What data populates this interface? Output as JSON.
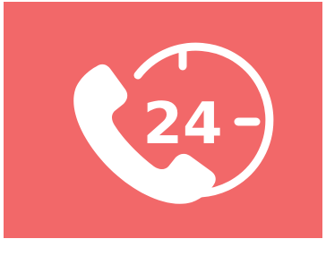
{
  "icon": {
    "name": "24-hour-support-phone-icon",
    "badge_text": "24",
    "background_color": "#f26869",
    "foreground_color": "#ffffff"
  }
}
